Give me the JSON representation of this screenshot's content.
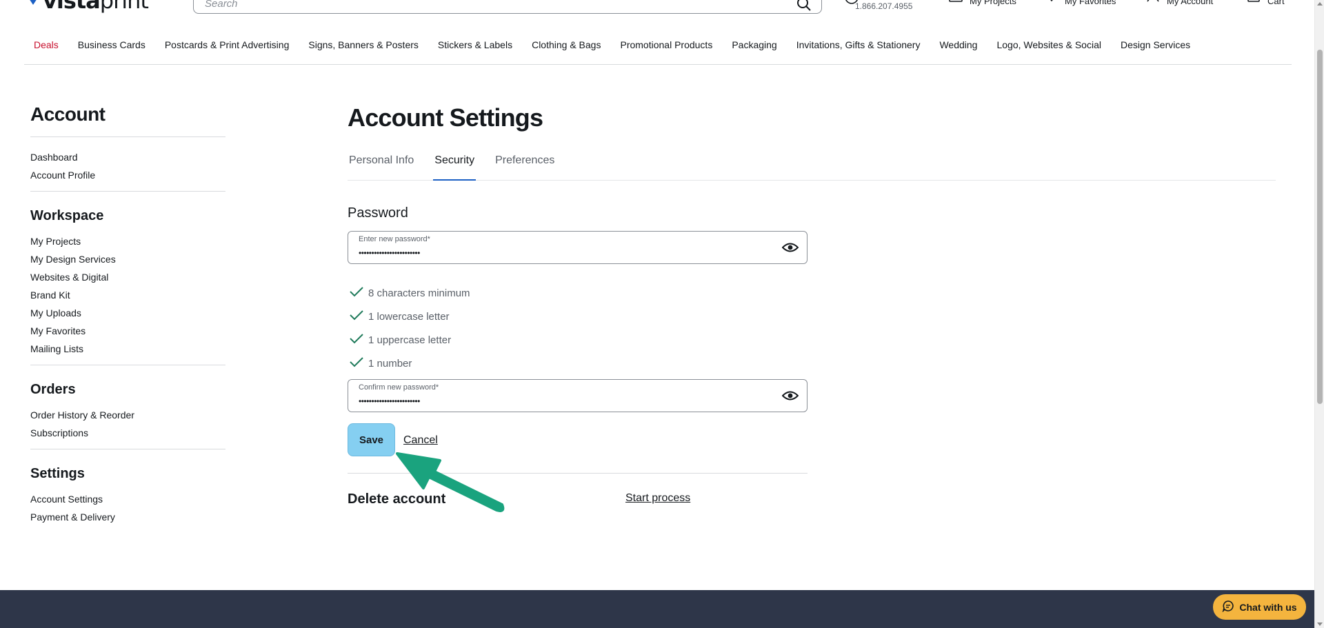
{
  "header": {
    "logo_bold": "vista",
    "logo_light": "print",
    "search_placeholder": "Search",
    "phone": "1.866.207.4955",
    "my_projects": "My Projects",
    "my_favorites": "My Favorites",
    "my_account": "My Account",
    "cart": "Cart"
  },
  "category_nav": [
    "Deals",
    "Business Cards",
    "Postcards & Print Advertising",
    "Signs, Banners & Posters",
    "Stickers & Labels",
    "Clothing & Bags",
    "Promotional Products",
    "Packaging",
    "Invitations, Gifts & Stationery",
    "Wedding",
    "Logo, Websites & Social",
    "Design Services"
  ],
  "sidebar": {
    "account_title": "Account",
    "account_links": [
      "Dashboard",
      "Account Profile"
    ],
    "workspace_title": "Workspace",
    "workspace_links": [
      "My Projects",
      "My Design Services",
      "Websites & Digital",
      "Brand Kit",
      "My Uploads",
      "My Favorites",
      "Mailing Lists"
    ],
    "orders_title": "Orders",
    "orders_links": [
      "Order History & Reorder",
      "Subscriptions"
    ],
    "settings_title": "Settings",
    "settings_links": [
      "Account Settings",
      "Payment & Delivery"
    ]
  },
  "main": {
    "title": "Account Settings",
    "tabs": [
      {
        "label": "Personal Info",
        "active": false
      },
      {
        "label": "Security",
        "active": true
      },
      {
        "label": "Preferences",
        "active": false
      }
    ],
    "password_heading": "Password",
    "new_password": {
      "label": "Enter new password*",
      "value": "••••••••••••••••••••••••"
    },
    "rules": [
      "8 characters minimum",
      "1 lowercase letter",
      "1 uppercase letter",
      "1 number"
    ],
    "confirm_password": {
      "label": "Confirm new password*",
      "value": "••••••••••••••••••••••••"
    },
    "save_label": "Save",
    "cancel_label": "Cancel",
    "delete_title": "Delete account",
    "delete_link": "Start process"
  },
  "chat_label": "Chat with us",
  "colors": {
    "accent_blue": "#1c60c4",
    "save_button": "#85cff1",
    "check_green": "#1e7a5a",
    "arrow_green": "#1aa37e",
    "footer_bg": "#2e3649",
    "chat_bg": "#f4b43e",
    "deals_red": "#c8102e"
  },
  "icons": {
    "search": "search-icon",
    "whatsapp": "chat-bubble-icon",
    "projects": "folder-icon",
    "favorites": "heart-icon",
    "account": "user-icon",
    "cart": "cart-icon",
    "eye": "eye-icon",
    "check": "check-icon",
    "chat": "chat-bubble-icon",
    "arrow": "pointer-arrow-icon"
  }
}
